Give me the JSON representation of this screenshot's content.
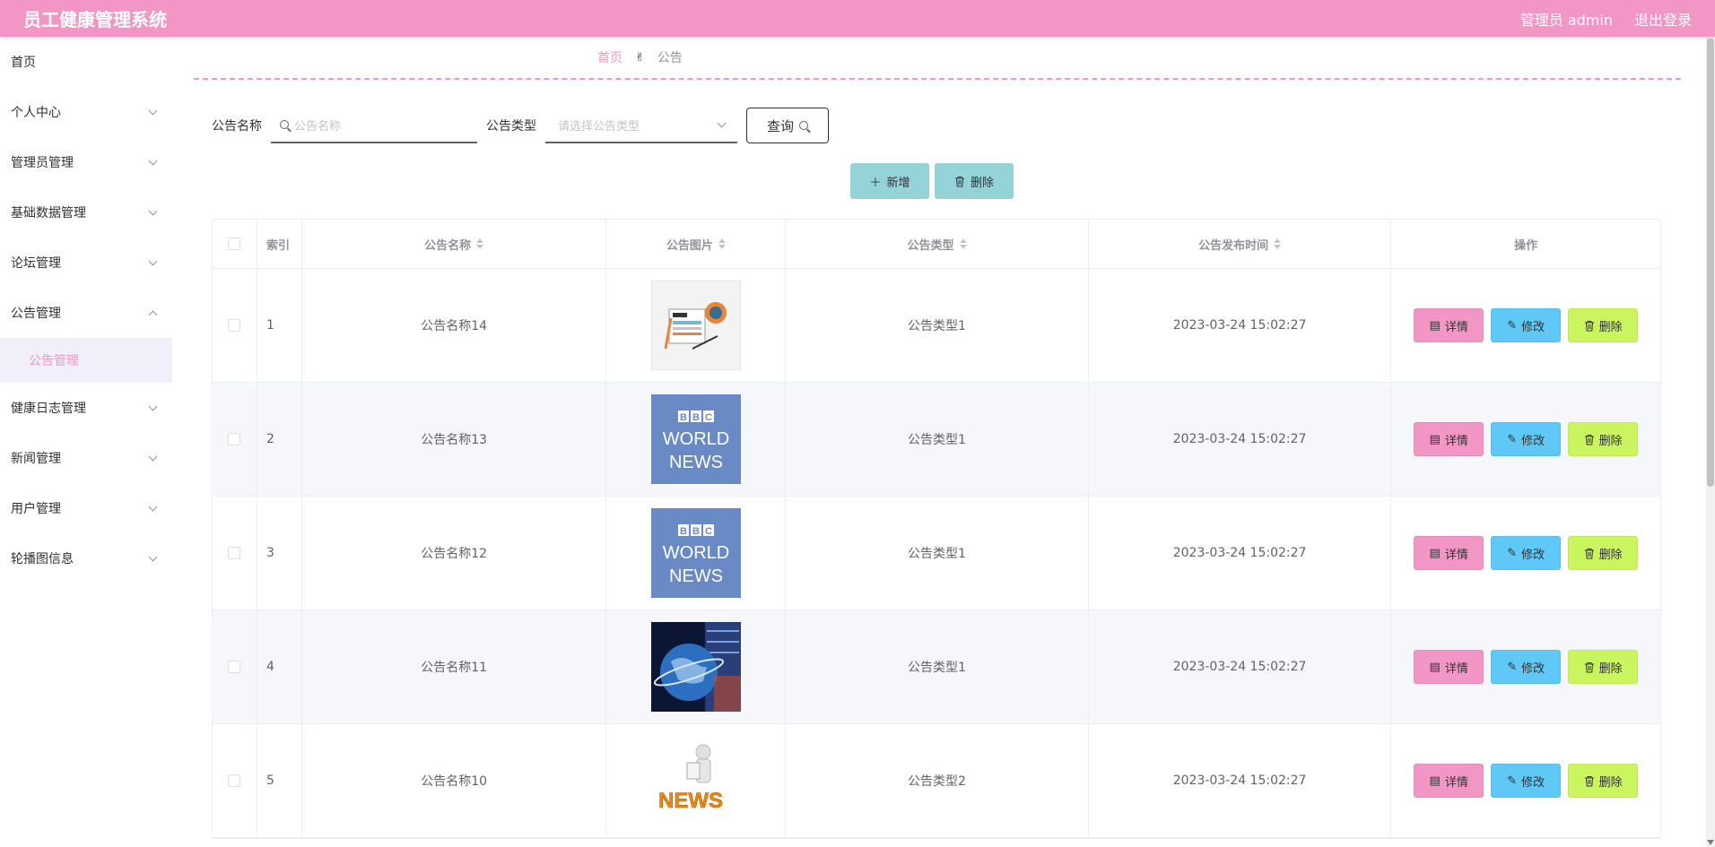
{
  "header": {
    "title": "员工健康管理系统",
    "user": "管理员 admin",
    "logout": "退出登录"
  },
  "colors": {
    "primary": "#f196c5",
    "edit": "#5fc8f6",
    "delete": "#cbf55f",
    "action": "#94d4d9"
  },
  "sidebar": {
    "items": [
      {
        "label": "首页",
        "has_chevron": false
      },
      {
        "label": "个人中心",
        "has_chevron": true
      },
      {
        "label": "管理员管理",
        "has_chevron": true
      },
      {
        "label": "基础数据管理",
        "has_chevron": true
      },
      {
        "label": "论坛管理",
        "has_chevron": true
      },
      {
        "label": "公告管理",
        "has_chevron": true,
        "expanded": true
      },
      {
        "label": "健康日志管理",
        "has_chevron": true
      },
      {
        "label": "新闻管理",
        "has_chevron": true
      },
      {
        "label": "用户管理",
        "has_chevron": true
      },
      {
        "label": "轮播图信息",
        "has_chevron": true
      }
    ],
    "submenu": {
      "label": "公告管理"
    }
  },
  "breadcrumb": {
    "home": "首页",
    "current": "公告"
  },
  "search": {
    "name_label": "公告名称",
    "name_placeholder": "公告名称",
    "type_label": "公告类型",
    "type_placeholder": "请选择公告类型",
    "query_label": "查询"
  },
  "actions": {
    "add": "新增",
    "delete": "删除"
  },
  "table": {
    "headers": {
      "index": "索引",
      "name": "公告名称",
      "image": "公告图片",
      "type": "公告类型",
      "time": "公告发布时间",
      "ops": "操作"
    },
    "op_labels": {
      "detail": "详情",
      "edit": "修改",
      "delete": "删除"
    },
    "rows": [
      {
        "index": "1",
        "name": "公告名称14",
        "image": "news-paper-icon",
        "type": "公告类型1",
        "time": "2023-03-24 15:02:27"
      },
      {
        "index": "2",
        "name": "公告名称13",
        "image": "bbc-world-news-logo",
        "type": "公告类型1",
        "time": "2023-03-24 15:02:27"
      },
      {
        "index": "3",
        "name": "公告名称12",
        "image": "bbc-world-news-logo",
        "type": "公告类型1",
        "time": "2023-03-24 15:02:27"
      },
      {
        "index": "4",
        "name": "公告名称11",
        "image": "globe-news-image",
        "type": "公告类型1",
        "time": "2023-03-24 15:02:27"
      },
      {
        "index": "5",
        "name": "公告名称10",
        "image": "news-3d-figure",
        "type": "公告类型2",
        "time": "2023-03-24 15:02:27"
      }
    ]
  }
}
